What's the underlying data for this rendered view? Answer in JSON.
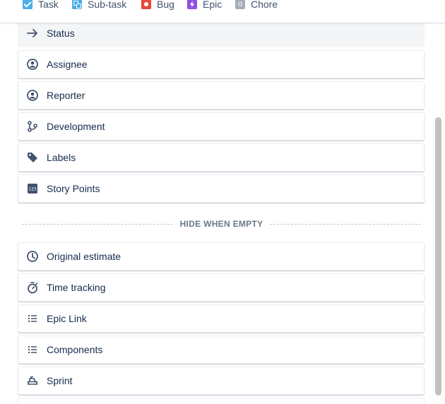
{
  "issue_types": [
    {
      "label": "Task",
      "icon": "task-icon"
    },
    {
      "label": "Sub-task",
      "icon": "subtask-icon"
    },
    {
      "label": "Bug",
      "icon": "bug-icon"
    },
    {
      "label": "Epic",
      "icon": "epic-icon"
    },
    {
      "label": "Chore",
      "icon": "chore-icon"
    }
  ],
  "fields_primary": [
    {
      "label": "Status",
      "icon": "arrow-right-icon"
    },
    {
      "label": "Assignee",
      "icon": "user-avatar-icon"
    },
    {
      "label": "Reporter",
      "icon": "user-avatar-icon"
    },
    {
      "label": "Development",
      "icon": "branch-icon"
    },
    {
      "label": "Labels",
      "icon": "tag-icon"
    },
    {
      "label": "Story Points",
      "icon": "number-icon"
    }
  ],
  "divider_label": "HIDE WHEN EMPTY",
  "fields_hidden_when_empty": [
    {
      "label": "Original estimate",
      "icon": "clock-icon"
    },
    {
      "label": "Time tracking",
      "icon": "stopwatch-icon"
    },
    {
      "label": "Epic Link",
      "icon": "list-icon"
    },
    {
      "label": "Components",
      "icon": "list-icon"
    },
    {
      "label": "Sprint",
      "icon": "ship-icon"
    }
  ],
  "colors": {
    "task": "#4bade8",
    "bug": "#e5493a",
    "epic": "#904ee2",
    "chore": "#a5adba",
    "text": "#172b4d",
    "icon": "#42526e"
  }
}
